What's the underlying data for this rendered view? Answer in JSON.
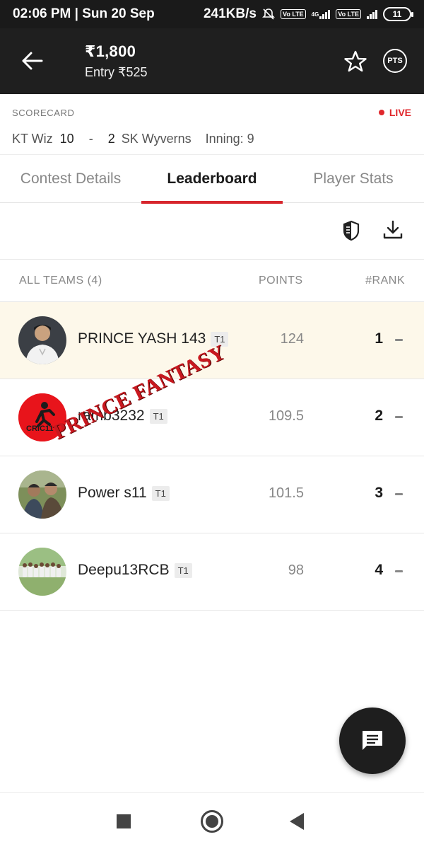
{
  "status_bar": {
    "time_date": "02:06 PM | Sun 20 Sep",
    "net_speed": "241KB/s",
    "volte_1": "Vo LTE",
    "net_type": "4G",
    "volte_2": "Vo LTE",
    "battery": "11"
  },
  "header": {
    "prize": "₹1,800",
    "entry": "Entry ₹525",
    "pts_label": "PTS"
  },
  "scorecard": {
    "label": "SCORECARD",
    "live": "LIVE",
    "team1": "KT Wiz",
    "score1": "10",
    "separator": "-",
    "score2": "2",
    "team2": "SK Wyverns",
    "inning": "Inning: 9"
  },
  "tabs": [
    {
      "label": "Contest Details"
    },
    {
      "label": "Leaderboard"
    },
    {
      "label": "Player Stats"
    }
  ],
  "table": {
    "col_teams": "ALL TEAMS (4)",
    "col_points": "POINTS",
    "col_rank": "#RANK",
    "rows": [
      {
        "name": "PRINCE YASH 143",
        "badge": "T1",
        "points": "124",
        "rank": "1"
      },
      {
        "name": "ramb3232",
        "badge": "T1",
        "points": "109.5",
        "rank": "2",
        "avatar_text": "CRIC11"
      },
      {
        "name": "Power s11",
        "badge": "T1",
        "points": "101.5",
        "rank": "3"
      },
      {
        "name": "Deepu13RCB",
        "badge": "T1",
        "points": "98",
        "rank": "4"
      }
    ]
  },
  "watermark": "PRINCE FANTASY",
  "colors": {
    "header_bg": "#1f1f1f",
    "accent_red": "#d7262d",
    "highlight_row": "#fdf8ea"
  }
}
